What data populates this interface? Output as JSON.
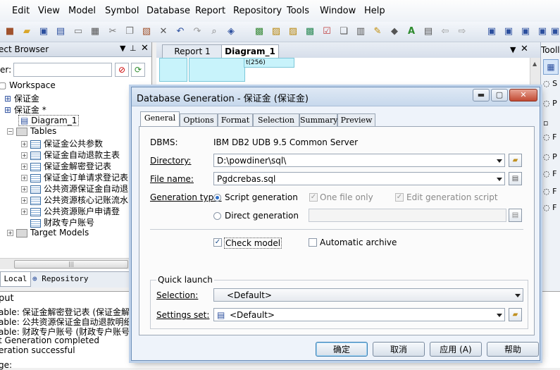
{
  "menu": [
    "Edit",
    "View",
    "Model",
    "Symbol",
    "Database",
    "Report",
    "Repository",
    "Tools",
    "Window",
    "Help"
  ],
  "browser": {
    "title": "ect Browser",
    "filter_label": "er:",
    "tree": {
      "workspace": "Workspace",
      "model1": "保证金",
      "model2": "保证金 *",
      "diagram": "Diagram_1",
      "tables": "Tables",
      "table_items": [
        "保证金公共参数",
        "保证金自动退款主表",
        "保证金解密登记表",
        "保证金订单请求登记表",
        "公共资源保证金自动退",
        "公共资源核心记账流水",
        "公共资源账户申请登",
        "财政专户账号"
      ],
      "target_models": "Target Models"
    },
    "tabs": [
      "Local",
      "Repository"
    ]
  },
  "output": {
    "title": "put",
    "lines": [
      "able: 保证金解密登记表 (保证金解密",
      "able: 公共资源保证金自动退款明细 (",
      "able: 财政专户账号 (财政专户账号)",
      "t Generation completed",
      "eration successful",
      "ge:"
    ]
  },
  "doc_tabs": [
    "Report 1",
    "Diagram_1"
  ],
  "canvas_fragment": "t(256)",
  "toolbox_title": "Tooll",
  "dialog": {
    "title": "Database Generation - 保证金 (保证金)",
    "tabs": [
      "General",
      "Options",
      "Format",
      "Selection",
      "Summary",
      "Preview"
    ],
    "dbms_label": "DBMS:",
    "dbms_value": "IBM DB2 UDB 9.5 Common Server",
    "directory_label": "Directory:",
    "directory_value": "D:\\powdiner\\sql\\",
    "filename_label": "File name:",
    "filename_value": "Pgdcrebas.sql",
    "gen_type_label": "Generation type:",
    "script_gen": "Script generation",
    "direct_gen": "Direct generation",
    "one_file_only": "One file only",
    "edit_gen_script": "Edit generation script",
    "check_model": "Check model",
    "auto_archive": "Automatic archive",
    "quick_launch": "Quick launch",
    "selection_label": "Selection:",
    "selection_value": "<Default>",
    "settings_label": "Settings set:",
    "settings_value": "<Default>",
    "buttons": {
      "ok": "确定",
      "cancel": "取消",
      "apply": "应用 (A)",
      "help": "帮助"
    }
  }
}
